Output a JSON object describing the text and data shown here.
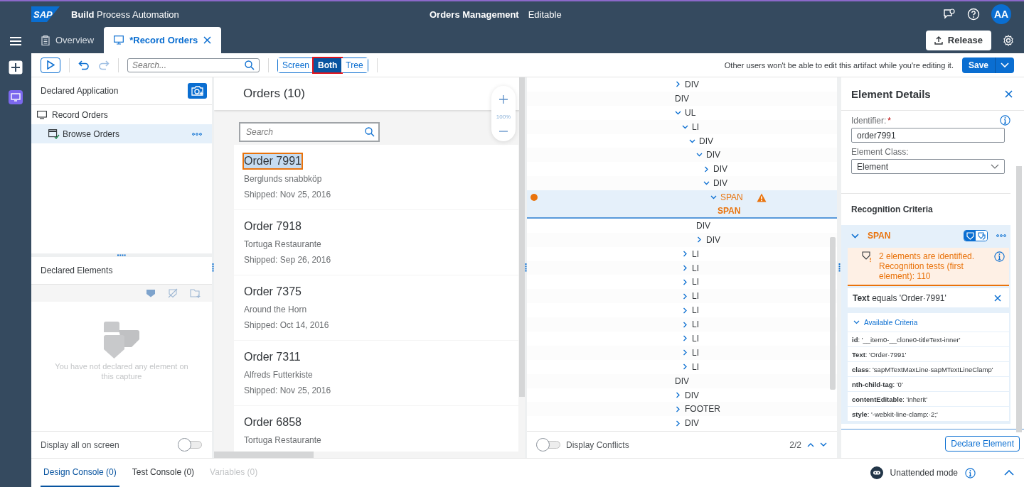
{
  "shell": {
    "logo": "SAP",
    "product": "**Build** Process Automation",
    "title": "Orders Management",
    "status": "Editable",
    "avatar": "AA"
  },
  "tabs": [
    {
      "label": "Overview",
      "kind": "overview",
      "selected": false,
      "closable": false
    },
    {
      "label": "*Record Orders",
      "kind": "capture",
      "selected": true,
      "closable": true
    }
  ],
  "release_button": "Release",
  "toolbar": {
    "undo": {
      "disabled": false
    },
    "redo": {
      "disabled": true
    },
    "search": {
      "placeholder": "Search..."
    },
    "views": [
      {
        "label": "Screen",
        "selected": false
      },
      {
        "label": "Both",
        "selected": true
      },
      {
        "label": "Tree",
        "selected": false
      }
    ],
    "notice": "Other users won't be able to edit this artifact while you're editing it.",
    "save": "Save"
  },
  "application": {
    "title": "Declared Application",
    "tree": [
      {
        "label": "Record Orders",
        "selected": false,
        "children": [
          {
            "label": "Browse Orders",
            "selected": true
          }
        ]
      }
    ]
  },
  "declared_elements": {
    "title": "Declared Elements",
    "empty_text": "You have not declared any element on this capture",
    "display_all": {
      "label": "Display all on screen",
      "on": false
    }
  },
  "screen": {
    "title": "Orders (10)",
    "search": {
      "placeholder": "Search"
    },
    "zoom": "100%",
    "orders": [
      {
        "title": "Order 7991",
        "customer": "Berglunds snabbköp",
        "shipped": "Shipped: Nov 25, 2016",
        "selected": true
      },
      {
        "title": "Order 7918",
        "customer": "Tortuga Restaurante",
        "shipped": "Shipped: Sep 26, 2016",
        "selected": false
      },
      {
        "title": "Order 7375",
        "customer": "Around the Horn",
        "shipped": "Shipped: Oct 14, 2016",
        "selected": false
      },
      {
        "title": "Order 7311",
        "customer": "Alfreds Futterkiste",
        "shipped": "Shipped: Nov 25, 2016",
        "selected": false
      },
      {
        "title": "Order 6858",
        "customer": "Tortuga Restaurante",
        "selected": false
      }
    ]
  },
  "dom_tree": {
    "nodes": [
      {
        "label": "DIV",
        "expanded": false,
        "selected": false
      },
      {
        "label": "DIV",
        "selected": false
      },
      {
        "label": "UL",
        "expanded": true,
        "selected": false,
        "children": [
          {
            "label": "LI",
            "expanded": true,
            "selected": false,
            "children": [
              {
                "label": "DIV",
                "expanded": true,
                "selected": false,
                "children": [
                  {
                    "label": "DIV",
                    "expanded": true,
                    "selected": false,
                    "children": [
                      {
                        "label": "DIV",
                        "expanded": false,
                        "selected": false
                      },
                      {
                        "label": "DIV",
                        "expanded": true,
                        "selected": false,
                        "children": [
                          {
                            "label": "SPAN",
                            "expanded": true,
                            "selected": true,
                            "warning": true,
                            "children": [
                              {
                                "label": "SPAN",
                                "selected": true
                              }
                            ]
                          }
                        ]
                      }
                    ]
                  },
                  {
                    "label": "DIV",
                    "selected": false
                  },
                  {
                    "label": "DIV",
                    "expanded": false,
                    "selected": false
                  }
                ]
              }
            ]
          },
          {
            "label": "LI",
            "expanded": false,
            "selected": false
          },
          {
            "label": "LI",
            "expanded": false,
            "selected": false
          },
          {
            "label": "LI",
            "expanded": false,
            "selected": false
          },
          {
            "label": "LI",
            "expanded": false,
            "selected": false
          },
          {
            "label": "LI",
            "expanded": false,
            "selected": false
          },
          {
            "label": "LI",
            "expanded": false,
            "selected": false
          },
          {
            "label": "LI",
            "expanded": false,
            "selected": false
          },
          {
            "label": "LI",
            "expanded": false,
            "selected": false
          },
          {
            "label": "LI",
            "expanded": false,
            "selected": false
          }
        ]
      },
      {
        "label": "DIV",
        "selected": false
      },
      {
        "label": "DIV",
        "expanded": false,
        "selected": false
      },
      {
        "label": "FOOTER",
        "expanded": false,
        "selected": false
      },
      {
        "label": "DIV",
        "expanded": false,
        "selected": false
      }
    ],
    "conflicts": {
      "label": "Display Conflicts",
      "on": false
    },
    "counter": "2/2"
  },
  "details": {
    "title": "Element Details",
    "identifier": {
      "label": "Identifier:",
      "required_mark": "*",
      "value": "order7991"
    },
    "element_class": {
      "label": "Element Class:",
      "value": "Element"
    },
    "recognition": {
      "title": "Recognition Criteria",
      "tag": "SPAN",
      "expanded": true,
      "message": "2 elements are identified. Recognition tests (first element): 110",
      "criteria": [
        "**Text** equals 'Order·7991'"
      ],
      "available": {
        "label": "Available Criteria",
        "expanded": true,
        "items": [
          "**id**: '__item0-__clone0-titleText-inner'",
          "**Text**: 'Order·7991'",
          "**class**: 'sapMTextMaxLine·sapMTextLineClamp'",
          "**nth-child-tag**: '0'",
          "**contentEditable**: 'inherit'",
          "**style**: '-webkit-line-clamp:·2;'"
        ]
      }
    },
    "declare_button": "Declare Element"
  },
  "consoles": [
    {
      "label": "Design Console (0)",
      "selected": true,
      "disabled": false
    },
    {
      "label": "Test Console (0)",
      "selected": false,
      "disabled": false
    },
    {
      "label": "Variables (0)",
      "selected": false,
      "disabled": true
    }
  ],
  "unattended": "Unattended mode"
}
